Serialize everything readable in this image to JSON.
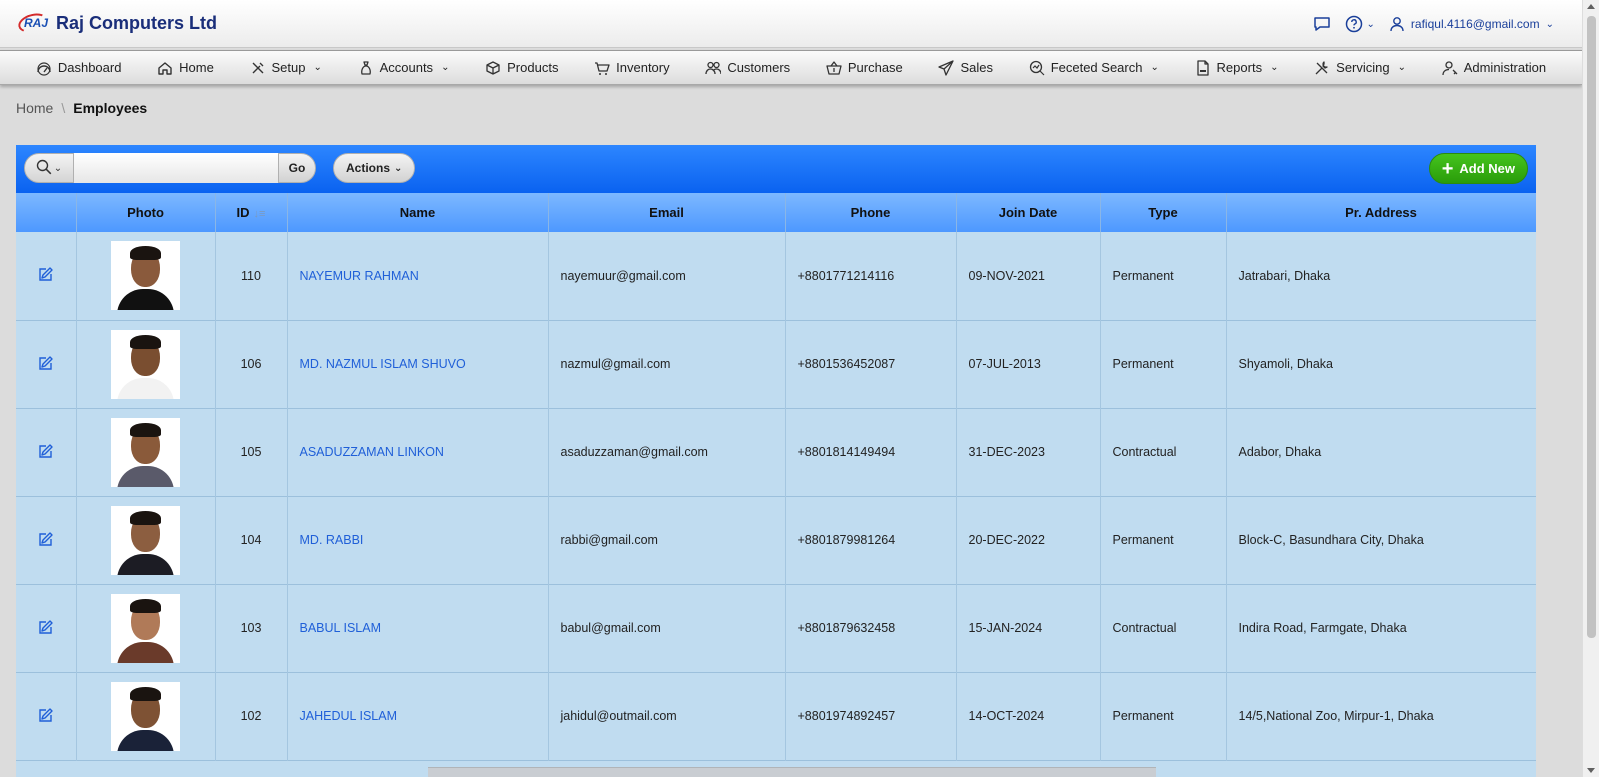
{
  "app": {
    "logo_text": "RAJ",
    "name": "Raj Computers Ltd"
  },
  "header": {
    "user_email": "rafiqul.4116@gmail.com",
    "icons": [
      "chat-icon",
      "help-icon",
      "user-icon"
    ]
  },
  "nav": {
    "items": [
      {
        "label": "Dashboard",
        "icon": "dashboard-icon",
        "dropdown": false
      },
      {
        "label": "Home",
        "icon": "home-icon",
        "dropdown": false
      },
      {
        "label": "Setup",
        "icon": "tools-icon",
        "dropdown": true
      },
      {
        "label": "Accounts",
        "icon": "money-bag-icon",
        "dropdown": true
      },
      {
        "label": "Products",
        "icon": "box-icon",
        "dropdown": false
      },
      {
        "label": "Inventory",
        "icon": "cart-icon",
        "dropdown": false
      },
      {
        "label": "Customers",
        "icon": "users-icon",
        "dropdown": false
      },
      {
        "label": "Purchase",
        "icon": "basket-icon",
        "dropdown": false
      },
      {
        "label": "Sales",
        "icon": "send-icon",
        "dropdown": false
      },
      {
        "label": "Feceted Search",
        "icon": "search-chart-icon",
        "dropdown": true
      },
      {
        "label": "Reports",
        "icon": "pdf-icon",
        "dropdown": true
      },
      {
        "label": "Servicing",
        "icon": "wrench-icon",
        "dropdown": true
      },
      {
        "label": "Administration",
        "icon": "admin-icon",
        "dropdown": false
      }
    ]
  },
  "breadcrumb": {
    "home": "Home",
    "separator": "\\",
    "current": "Employees"
  },
  "toolbar": {
    "search_placeholder": "",
    "go_label": "Go",
    "actions_label": "Actions",
    "add_new_label": "Add New"
  },
  "table": {
    "columns": [
      "",
      "Photo",
      "ID",
      "Name",
      "Email",
      "Phone",
      "Join Date",
      "Type",
      "Pr. Address"
    ],
    "rows": [
      {
        "id": "110",
        "name": "NAYEMUR RAHMAN",
        "email": "nayemuur@gmail.com",
        "phone": "+8801771214116",
        "join_date": "09-NOV-2021",
        "type": "Permanent",
        "address": "Jatrabari, Dhaka"
      },
      {
        "id": "106",
        "name": "MD. NAZMUL ISLAM SHUVO",
        "email": "nazmul@gmail.com",
        "phone": "+8801536452087",
        "join_date": "07-JUL-2013",
        "type": "Permanent",
        "address": "Shyamoli, Dhaka"
      },
      {
        "id": "105",
        "name": "ASADUZZAMAN LINKON",
        "email": "asaduzzaman@gmail.com",
        "phone": "+8801814149494",
        "join_date": "31-DEC-2023",
        "type": "Contractual",
        "address": "Adabor, Dhaka"
      },
      {
        "id": "104",
        "name": "MD. RABBI",
        "email": "rabbi@gmail.com",
        "phone": "+8801879981264",
        "join_date": "20-DEC-2022",
        "type": "Permanent",
        "address": "Block-C, Basundhara City, Dhaka"
      },
      {
        "id": "103",
        "name": "BABUL ISLAM",
        "email": "babul@gmail.com",
        "phone": "+8801879632458",
        "join_date": "15-JAN-2024",
        "type": "Contractual",
        "address": "Indira Road, Farmgate, Dhaka"
      },
      {
        "id": "102",
        "name": "JAHEDUL ISLAM",
        "email": "jahidul@outmail.com",
        "phone": "+8801974892457",
        "join_date": "14-OCT-2024",
        "type": "Permanent",
        "address": "14/5,National Zoo, Mirpur-1, Dhaka"
      }
    ]
  },
  "colors": {
    "toolbar_blue": "#0a62f0",
    "header_blue": "#4d98ff",
    "row_bg": "#c0dcf0",
    "link": "#1f5fd8",
    "add_new_green": "#2a9c0a",
    "brand_navy": "#1a2e7a"
  }
}
